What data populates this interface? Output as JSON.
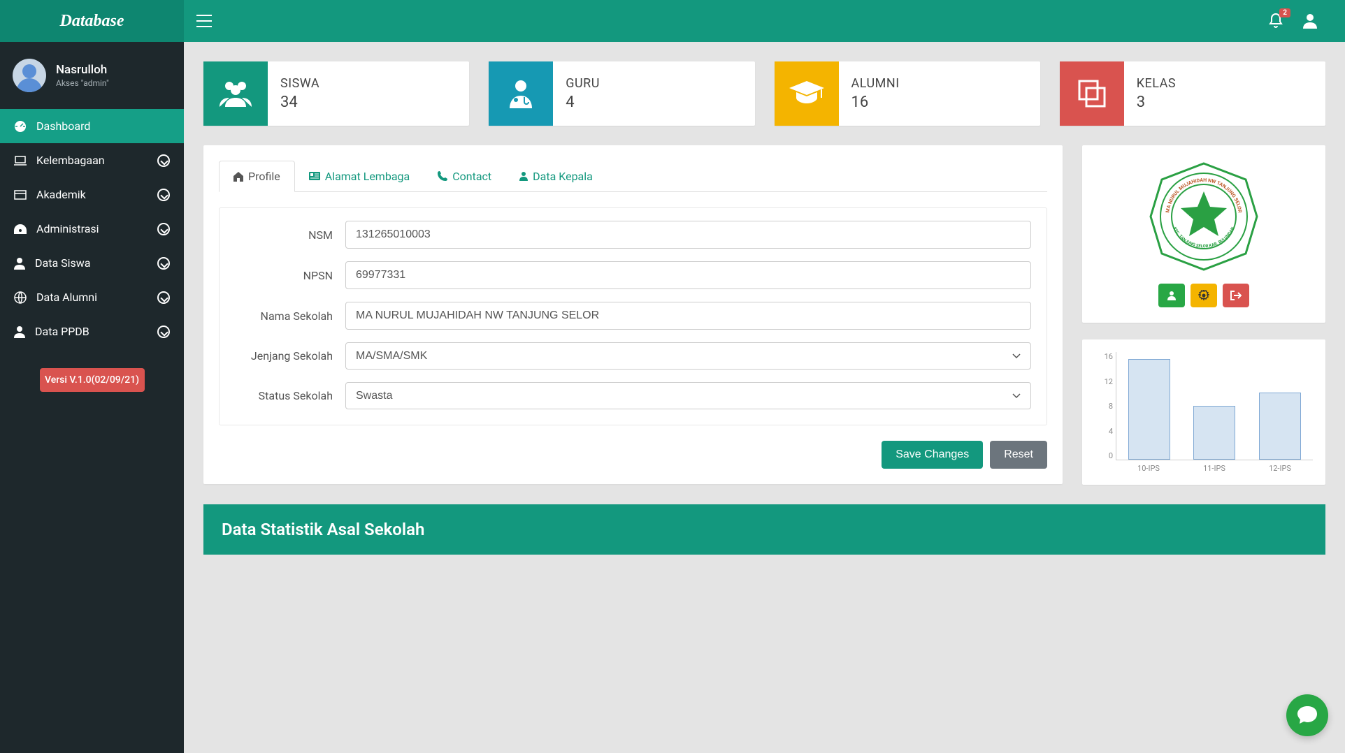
{
  "brand": "Database",
  "notification_count": "2",
  "user": {
    "name": "Nasrulloh",
    "role": "Akses \"admin\""
  },
  "sidebar": {
    "items": [
      {
        "label": "Dashboard"
      },
      {
        "label": "Kelembagaan"
      },
      {
        "label": "Akademik"
      },
      {
        "label": "Administrasi"
      },
      {
        "label": "Data Siswa"
      },
      {
        "label": "Data Alumni"
      },
      {
        "label": "Data PPDB"
      }
    ],
    "version": "Versi V.1.0(02/09/21)"
  },
  "stats": [
    {
      "title": "SISWA",
      "value": "34",
      "color": "#13987e"
    },
    {
      "title": "GURU",
      "value": "4",
      "color": "#1699b3"
    },
    {
      "title": "ALUMNI",
      "value": "16",
      "color": "#f4b400"
    },
    {
      "title": "KELAS",
      "value": "3",
      "color": "#d9534f"
    }
  ],
  "tabs": [
    {
      "label": "Profile"
    },
    {
      "label": "Alamat Lembaga"
    },
    {
      "label": "Contact"
    },
    {
      "label": "Data Kepala"
    }
  ],
  "form": {
    "nsm": {
      "label": "NSM",
      "value": "131265010003"
    },
    "npsn": {
      "label": "NPSN",
      "value": "69977331"
    },
    "nama": {
      "label": "Nama Sekolah",
      "value": "MA NURUL MUJAHIDAH NW TANJUNG SELOR"
    },
    "jenjang": {
      "label": "Jenjang Sekolah",
      "value": "MA/SMA/SMK"
    },
    "status": {
      "label": "Status Sekolah",
      "value": "Swasta"
    },
    "save": "Save Changes",
    "reset": "Reset"
  },
  "logo_text": "MA NURUL MUJAHIDAH NW TANJUNG SELOR",
  "chart_data": {
    "type": "bar",
    "categories": [
      "10-IPS",
      "11-IPS",
      "12-IPS"
    ],
    "values": [
      15,
      8,
      10
    ],
    "ylim": [
      0,
      16
    ],
    "yticks": [
      0,
      4,
      8,
      12,
      16
    ]
  },
  "stat_header": "Data Statistik Asal Sekolah"
}
